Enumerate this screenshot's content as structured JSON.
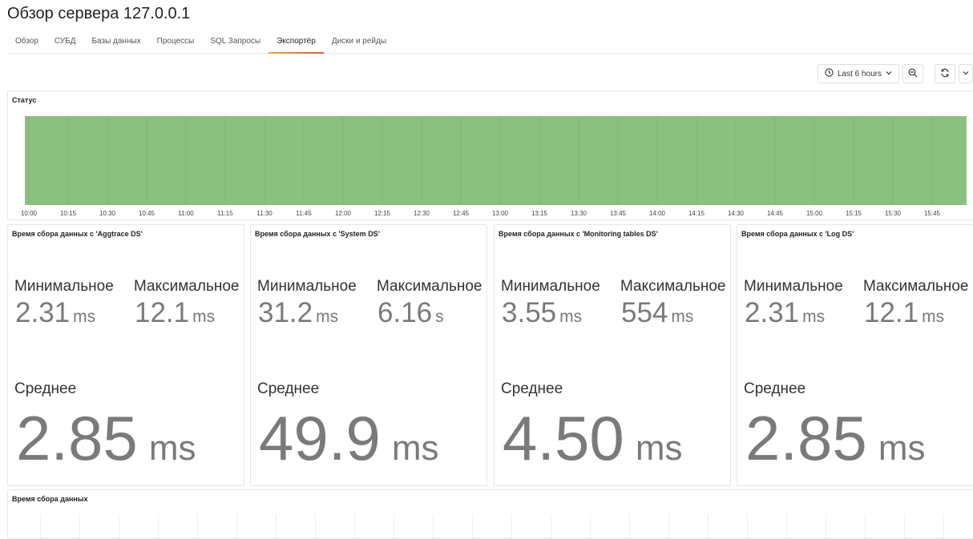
{
  "page": {
    "title": "Обзор сервера 127.0.0.1"
  },
  "tabs": [
    {
      "label": "Обзор",
      "active": false
    },
    {
      "label": "СУБД",
      "active": false
    },
    {
      "label": "Базы данных",
      "active": false
    },
    {
      "label": "Процессы",
      "active": false
    },
    {
      "label": "SQL Запросы",
      "active": false
    },
    {
      "label": "Экспортёр",
      "active": true
    },
    {
      "label": "Диски и рейды",
      "active": false
    }
  ],
  "toolbar": {
    "time_range": "Last 6 hours",
    "clock_icon": "clock-icon",
    "zoom_icon": "zoom-out-icon",
    "refresh_icon": "refresh-icon",
    "chevron_icon": "chevron-down-icon"
  },
  "status_panel": {
    "title": "Статус",
    "fill_color": "#8ac17e",
    "time_ticks": [
      "10:00",
      "10:15",
      "10:30",
      "10:45",
      "11:00",
      "11:15",
      "11:30",
      "11:45",
      "12:00",
      "12:15",
      "12:30",
      "12:45",
      "13:00",
      "13:15",
      "13:30",
      "13:45",
      "14:00",
      "14:15",
      "14:30",
      "14:45",
      "15:00",
      "15:15",
      "15:30",
      "15:45"
    ]
  },
  "stat_panels": [
    {
      "title": "Время сбора данных с 'Aggtrace DS'",
      "min_label": "Минимальное",
      "min_value": "2.31",
      "min_unit": "ms",
      "max_label": "Максимальное",
      "max_value": "12.1",
      "max_unit": "ms",
      "avg_label": "Среднее",
      "avg_value": "2.85",
      "avg_unit": "ms"
    },
    {
      "title": "Время сбора данных с 'System DS'",
      "min_label": "Минимальное",
      "min_value": "31.2",
      "min_unit": "ms",
      "max_label": "Максимальное",
      "max_value": "6.16",
      "max_unit": "s",
      "avg_label": "Среднее",
      "avg_value": "49.9",
      "avg_unit": "ms"
    },
    {
      "title": "Время сбора данных с 'Monitoring tables DS'",
      "min_label": "Минимальное",
      "min_value": "3.55",
      "min_unit": "ms",
      "max_label": "Максимальное",
      "max_value": "554",
      "max_unit": "ms",
      "avg_label": "Среднее",
      "avg_value": "4.50",
      "avg_unit": "ms"
    },
    {
      "title": "Время сбора данных с 'Log DS'",
      "min_label": "Минимальное",
      "min_value": "2.31",
      "min_unit": "ms",
      "max_label": "Максимальное",
      "max_value": "12.1",
      "max_unit": "ms",
      "avg_label": "Среднее",
      "avg_value": "2.85",
      "avg_unit": "ms"
    }
  ],
  "bottom_panel": {
    "title": "Время сбора данных"
  },
  "colors": {
    "accent": "#e8533a",
    "status_ok": "#8ac17e",
    "value_gray": "#7a7a7a"
  }
}
